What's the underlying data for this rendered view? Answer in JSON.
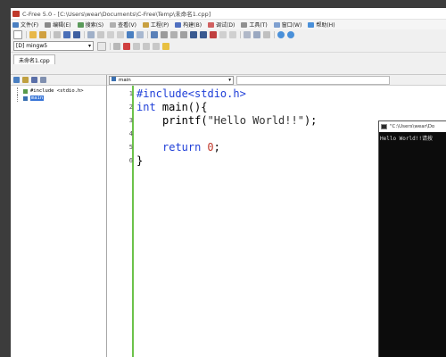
{
  "window_title": "C-Free 5.0 - [C:\\Users\\wear\\Documents\\C-Free\\Temp\\未命名1.cpp]",
  "menu": [
    "文件(F)",
    "编辑(E)",
    "搜索(S)",
    "查看(V)",
    "工程(P)",
    "构建(B)",
    "调试(D)",
    "工具(T)",
    "窗口(W)",
    "帮助(H)"
  ],
  "compiler": {
    "selected": "[D] mingw5"
  },
  "file_tab": "未命名1.cpp",
  "tree": {
    "include_item": "#include <stdio.h>",
    "main_item": "main"
  },
  "function_select": "main",
  "code": {
    "line_numbers": [
      "1",
      "2",
      "3",
      "4",
      "5",
      "6"
    ],
    "l1_directive": "#include",
    "l1_header": "<stdio.h>",
    "l2_type": "int",
    "l2_rest": " main(){",
    "l3_func": "printf(",
    "l3_str": "\"Hello World!!\"",
    "l3_end": ");",
    "l5_kw": "return",
    "l5_num": "0",
    "l5_end": ";",
    "l6": "}"
  },
  "console": {
    "title": "\"C:\\Users\\wear\\Do",
    "output": "Hello World!!请按"
  },
  "colors": {
    "keyword": "#1f3fd8",
    "number": "#c0392b",
    "gutter_bar": "#6cc24a",
    "console_bg": "#0c0c0c",
    "selection": "#3875d7"
  }
}
